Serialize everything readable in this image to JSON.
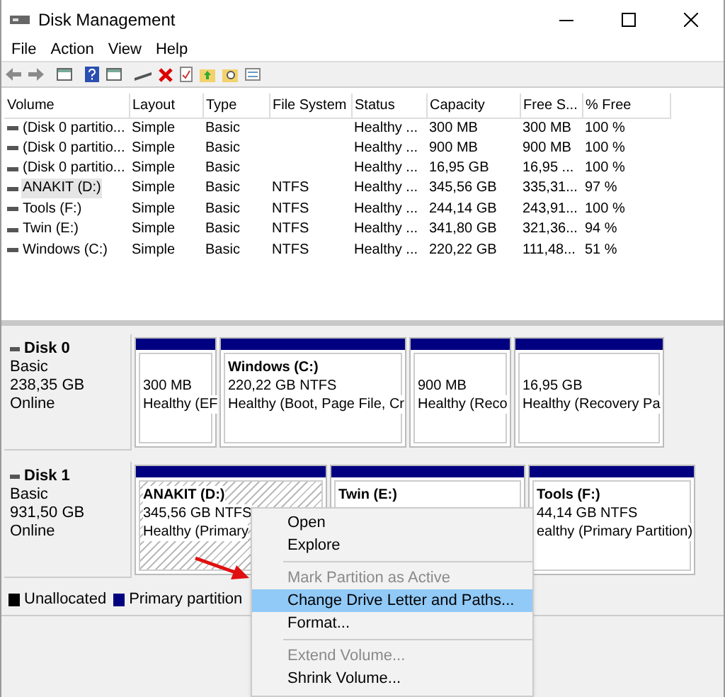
{
  "window": {
    "title": "Disk Management"
  },
  "menu_bar": [
    "File",
    "Action",
    "View",
    "Help"
  ],
  "volume_table": {
    "columns": [
      "Volume",
      "Layout",
      "Type",
      "File System",
      "Status",
      "Capacity",
      "Free S...",
      "% Free"
    ],
    "rows": [
      {
        "cells": [
          "(Disk 0 partitio...",
          "Simple",
          "Basic",
          "",
          "Healthy ...",
          "300 MB",
          "300 MB",
          "100 %"
        ],
        "selected": false
      },
      {
        "cells": [
          "(Disk 0 partitio...",
          "Simple",
          "Basic",
          "",
          "Healthy ...",
          "900 MB",
          "900 MB",
          "100 %"
        ],
        "selected": false
      },
      {
        "cells": [
          "(Disk 0 partitio...",
          "Simple",
          "Basic",
          "",
          "Healthy ...",
          "16,95 GB",
          "16,95 ...",
          "100 %"
        ],
        "selected": false
      },
      {
        "cells": [
          "ANAKIT (D:)",
          "Simple",
          "Basic",
          "NTFS",
          "Healthy ...",
          "345,56 GB",
          "335,31...",
          "97 %"
        ],
        "selected": true
      },
      {
        "cells": [
          "Tools (F:)",
          "Simple",
          "Basic",
          "NTFS",
          "Healthy ...",
          "244,14 GB",
          "243,91...",
          "100 %"
        ],
        "selected": false
      },
      {
        "cells": [
          "Twin (E:)",
          "Simple",
          "Basic",
          "NTFS",
          "Healthy ...",
          "341,80 GB",
          "321,36...",
          "94 %"
        ],
        "selected": false
      },
      {
        "cells": [
          "Windows (C:)",
          "Simple",
          "Basic",
          "NTFS",
          "Healthy ...",
          "220,22 GB",
          "111,48...",
          "51 %"
        ],
        "selected": false
      }
    ]
  },
  "disks": [
    {
      "name": "Disk 0",
      "type": "Basic",
      "size": "238,35 GB",
      "status": "Online",
      "partitions": [
        {
          "lines": [
            "300 MB",
            "Healthy (EF"
          ],
          "selected": false
        },
        {
          "title": "Windows  (C:)",
          "lines": [
            "220,22 GB NTFS",
            "Healthy (Boot, Page File, Cr"
          ],
          "selected": false
        },
        {
          "lines": [
            "900 MB",
            "Healthy (Reco"
          ],
          "selected": false
        },
        {
          "lines": [
            "16,95 GB",
            "Healthy (Recovery Pa"
          ],
          "selected": false
        }
      ]
    },
    {
      "name": "Disk 1",
      "type": "Basic",
      "size": "931,50 GB",
      "status": "Online",
      "partitions": [
        {
          "title": "ANAKIT  (D:)",
          "lines": [
            "345,56 GB NTFS",
            "Healthy (Primary"
          ],
          "selected": true
        },
        {
          "title": "Twin  (E:)",
          "selected": false
        },
        {
          "title": "Tools  (F:)",
          "lines": [
            "44,14 GB NTFS",
            "ealthy (Primary Partition)"
          ],
          "selected": false
        }
      ]
    }
  ],
  "legend": [
    {
      "label": "Unallocated",
      "color": "#000000"
    },
    {
      "label": "Primary partition",
      "color": "#000080"
    }
  ],
  "context_menu": [
    {
      "kind": "item",
      "label": "Open",
      "disabled": false,
      "selected": false
    },
    {
      "kind": "item",
      "label": "Explore",
      "disabled": false,
      "selected": false
    },
    {
      "kind": "separator"
    },
    {
      "kind": "item",
      "label": "Mark Partition as Active",
      "disabled": true,
      "selected": false
    },
    {
      "kind": "item",
      "label": "Change Drive Letter and Paths...",
      "disabled": false,
      "selected": true
    },
    {
      "kind": "item",
      "label": "Format...",
      "disabled": false,
      "selected": false
    },
    {
      "kind": "separator"
    },
    {
      "kind": "item",
      "label": "Extend Volume...",
      "disabled": true,
      "selected": false
    },
    {
      "kind": "item",
      "label": "Shrink Volume...",
      "disabled": false,
      "selected": false
    }
  ]
}
